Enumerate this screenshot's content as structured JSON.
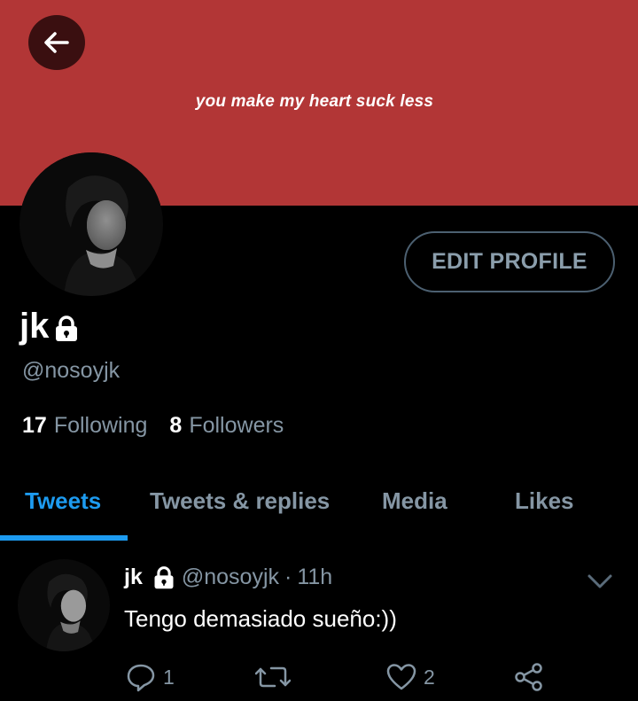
{
  "header": {
    "banner_text": "you make my heart suck less",
    "banner_color": "#b23636",
    "back_icon": "arrow-left-icon"
  },
  "profile": {
    "name": "jk",
    "handle": "@nosoyjk",
    "protected_icon": "lock-icon",
    "edit_button_label": "EDIT PROFILE",
    "following_count": "17",
    "following_label": "Following",
    "followers_count": "8",
    "followers_label": "Followers"
  },
  "tabs": [
    {
      "label": "Tweets",
      "active": true
    },
    {
      "label": "Tweets & replies",
      "active": false
    },
    {
      "label": "Media",
      "active": false
    },
    {
      "label": "Likes",
      "active": false
    }
  ],
  "accent_color": "#1d9bf0",
  "tweet": {
    "name": "jk",
    "handle": "@nosoyjk",
    "separator": "·",
    "time": "11h",
    "text": "Tengo demasiado sueño:))",
    "actions": {
      "reply_count": "1",
      "retweet_count": "",
      "like_count": "2"
    }
  }
}
